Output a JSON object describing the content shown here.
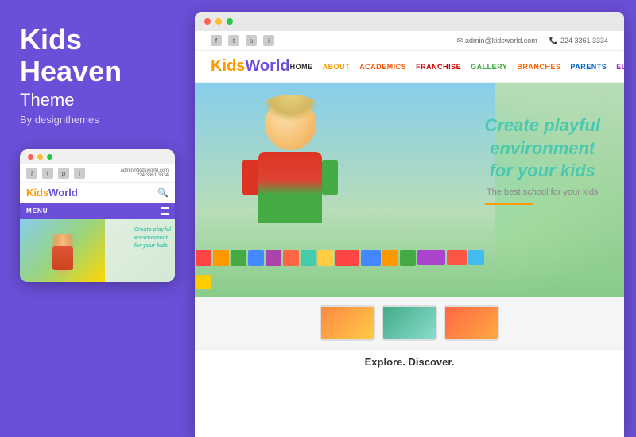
{
  "left": {
    "title_line1": "Kids",
    "title_line2": "Heaven",
    "subtitle": "Theme",
    "by": "By designthemes"
  },
  "mobile": {
    "social_icons": [
      "f",
      "t",
      "p",
      "i"
    ],
    "email": "admin@kidsworld.com",
    "phone": "224 3361 3334",
    "logo_kids": "Kids",
    "logo_world": "World",
    "menu_label": "MENU",
    "hero_text_line1": "Create playful",
    "hero_text_line2": "environment",
    "hero_text_line3": "for your kids"
  },
  "site": {
    "topbar": {
      "email": "admin@kidsworld.com",
      "phone": "224 3361 3334"
    },
    "logo_kids": "Kids",
    "logo_world": "World",
    "nav": {
      "home": "HOME",
      "about": "ABOUT",
      "academics": "ACADEMICS",
      "franchise": "FRANCHISE",
      "gallery": "GALLERY",
      "branches": "BRANCHES",
      "parents": "PARENTS",
      "elements": "ELEMENTS"
    },
    "hero": {
      "tagline_line1": "Create playful",
      "tagline_line2": "environment",
      "tagline_line3": "for your kids",
      "subtext": "The best school for your kids"
    },
    "explore_title": "Explore. Discover."
  },
  "browser_dots": [
    "red",
    "yellow",
    "green"
  ]
}
